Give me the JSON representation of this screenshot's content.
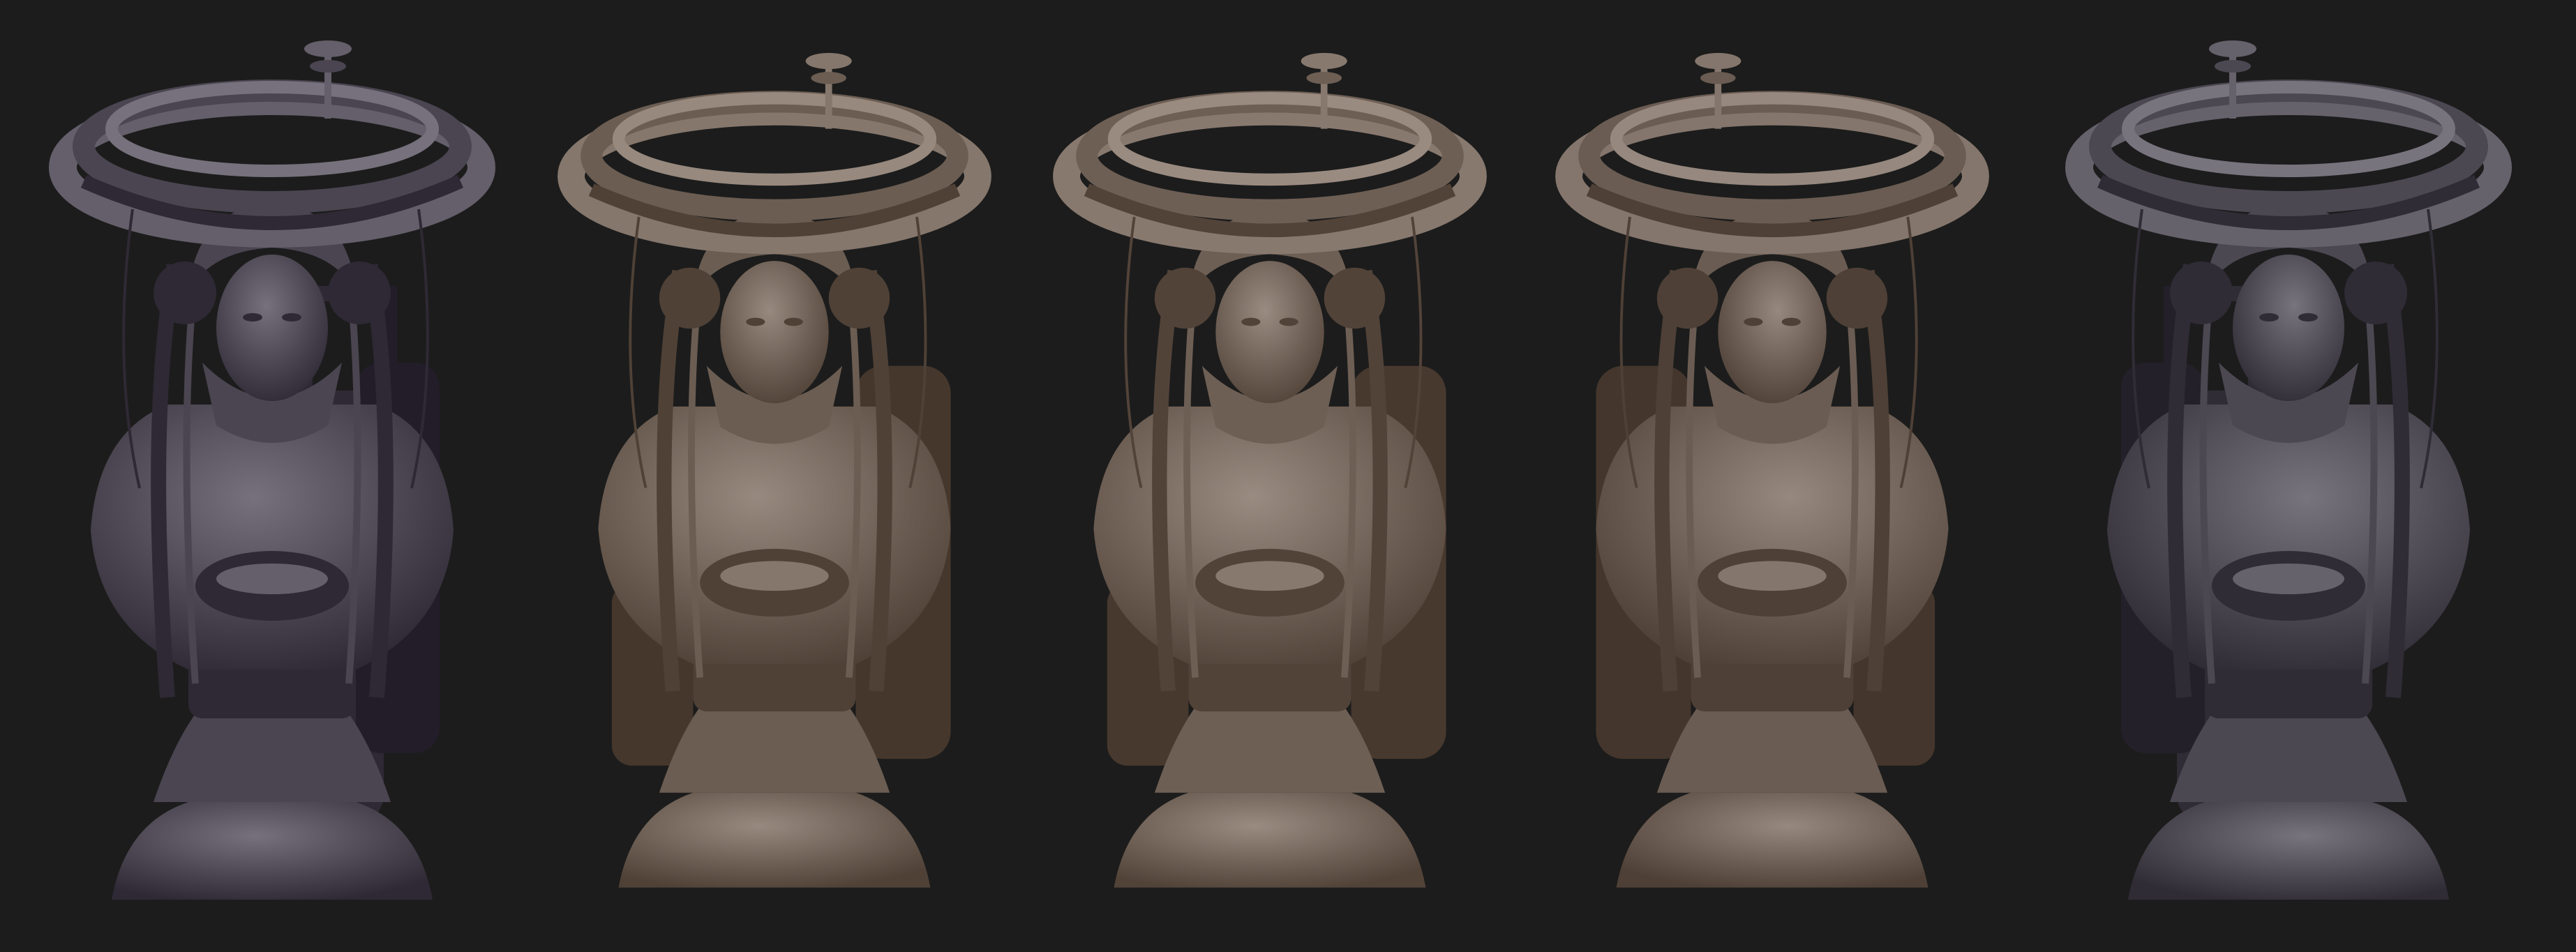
{
  "scene": {
    "background": "#1c1c1c",
    "views": [
      {
        "view": "left-profile",
        "color": "#4a4550",
        "mirror": false
      },
      {
        "view": "three-quarter-left",
        "color": "#6b5d52",
        "mirror": false
      },
      {
        "view": "front",
        "color": "#6e5f55",
        "mirror": false
      },
      {
        "view": "three-quarter-right",
        "color": "#6a5c52",
        "mirror": true
      },
      {
        "view": "right-profile",
        "color": "#4c4852",
        "mirror": true
      }
    ]
  }
}
